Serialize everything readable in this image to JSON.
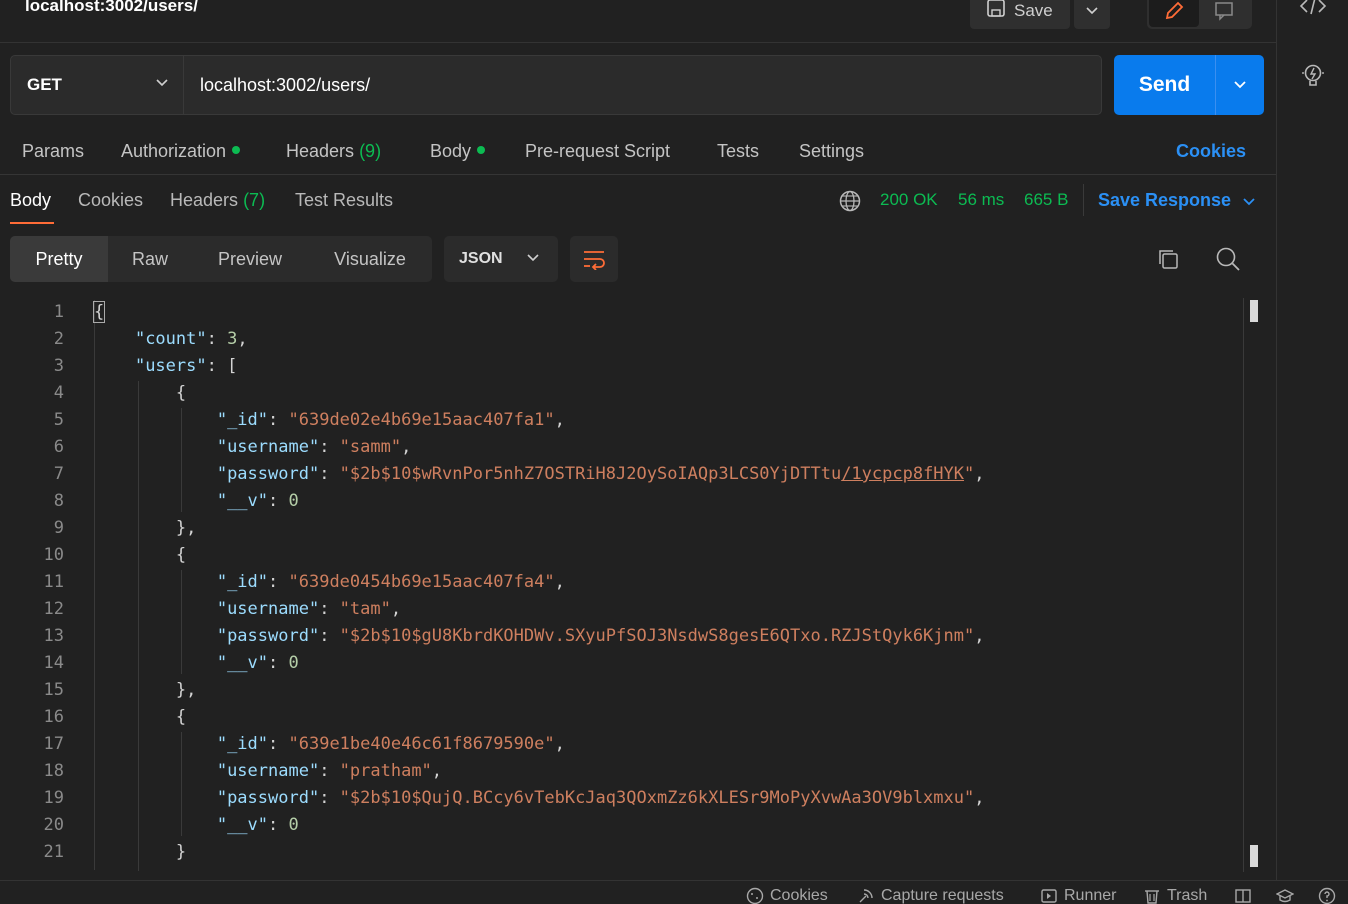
{
  "header": {
    "request_title": "localhost:3002/users/",
    "save_label": "Save"
  },
  "request": {
    "method": "GET",
    "url": "localhost:3002/users/",
    "send_label": "Send"
  },
  "request_tabs": {
    "params": "Params",
    "authorization": "Authorization",
    "headers": "Headers",
    "headers_count": "(9)",
    "body": "Body",
    "pre_request": "Pre-request Script",
    "tests": "Tests",
    "settings": "Settings",
    "cookies": "Cookies"
  },
  "response_tabs": {
    "body": "Body",
    "cookies": "Cookies",
    "headers": "Headers",
    "headers_count": "(7)",
    "test_results": "Test Results",
    "status": "200 OK",
    "time": "56 ms",
    "size": "665 B",
    "save_response": "Save Response"
  },
  "view_modes": {
    "pretty": "Pretty",
    "raw": "Raw",
    "preview": "Preview",
    "visualize": "Visualize",
    "format": "JSON"
  },
  "code": {
    "line_numbers": [
      "1",
      "2",
      "3",
      "4",
      "5",
      "6",
      "7",
      "8",
      "9",
      "10",
      "11",
      "12",
      "13",
      "14",
      "15",
      "16",
      "17",
      "18",
      "19",
      "20",
      "21"
    ],
    "count_key": "\"count\"",
    "count_value": "3",
    "users_key": "\"users\"",
    "id_key": "\"_id\"",
    "username_key": "\"username\"",
    "password_key": "\"password\"",
    "v_key": "\"__v\"",
    "v_value": "0",
    "users": [
      {
        "id": "\"639de02e4b69e15aac407fa1\"",
        "username": "\"samm\"",
        "password_a": "\"$2b$10$wRvnPor5nhZ7OSTRiH8J2OySoIAQp3LCS0YjDTTtu",
        "password_b": "/1ycpcp8fHYK",
        "password_c": "\""
      },
      {
        "id": "\"639de0454b69e15aac407fa4\"",
        "username": "\"tam\"",
        "password": "\"$2b$10$gU8KbrdKOHDWv.SXyuPfSOJ3NsdwS8gesE6QTxo.RZJStQyk6Kjnm\""
      },
      {
        "id": "\"639e1be40e46c61f8679590e\"",
        "username": "\"pratham\"",
        "password": "\"$2b$10$QujQ.BCcy6vTebKcJaq3QOxmZz6kXLESr9MoPyXvwAa3OV9blxmxu\""
      }
    ]
  },
  "statusbar": {
    "cookies": "Cookies",
    "capture": "Capture requests",
    "runner": "Runner",
    "trash": "Trash"
  },
  "colors": {
    "accent_blue": "#097bed",
    "status_green": "#0cbb52",
    "tab_underline": "#ff6c37",
    "json_key": "#9cdcfe",
    "json_string": "#ce7f5f",
    "json_number": "#b5cea8"
  }
}
